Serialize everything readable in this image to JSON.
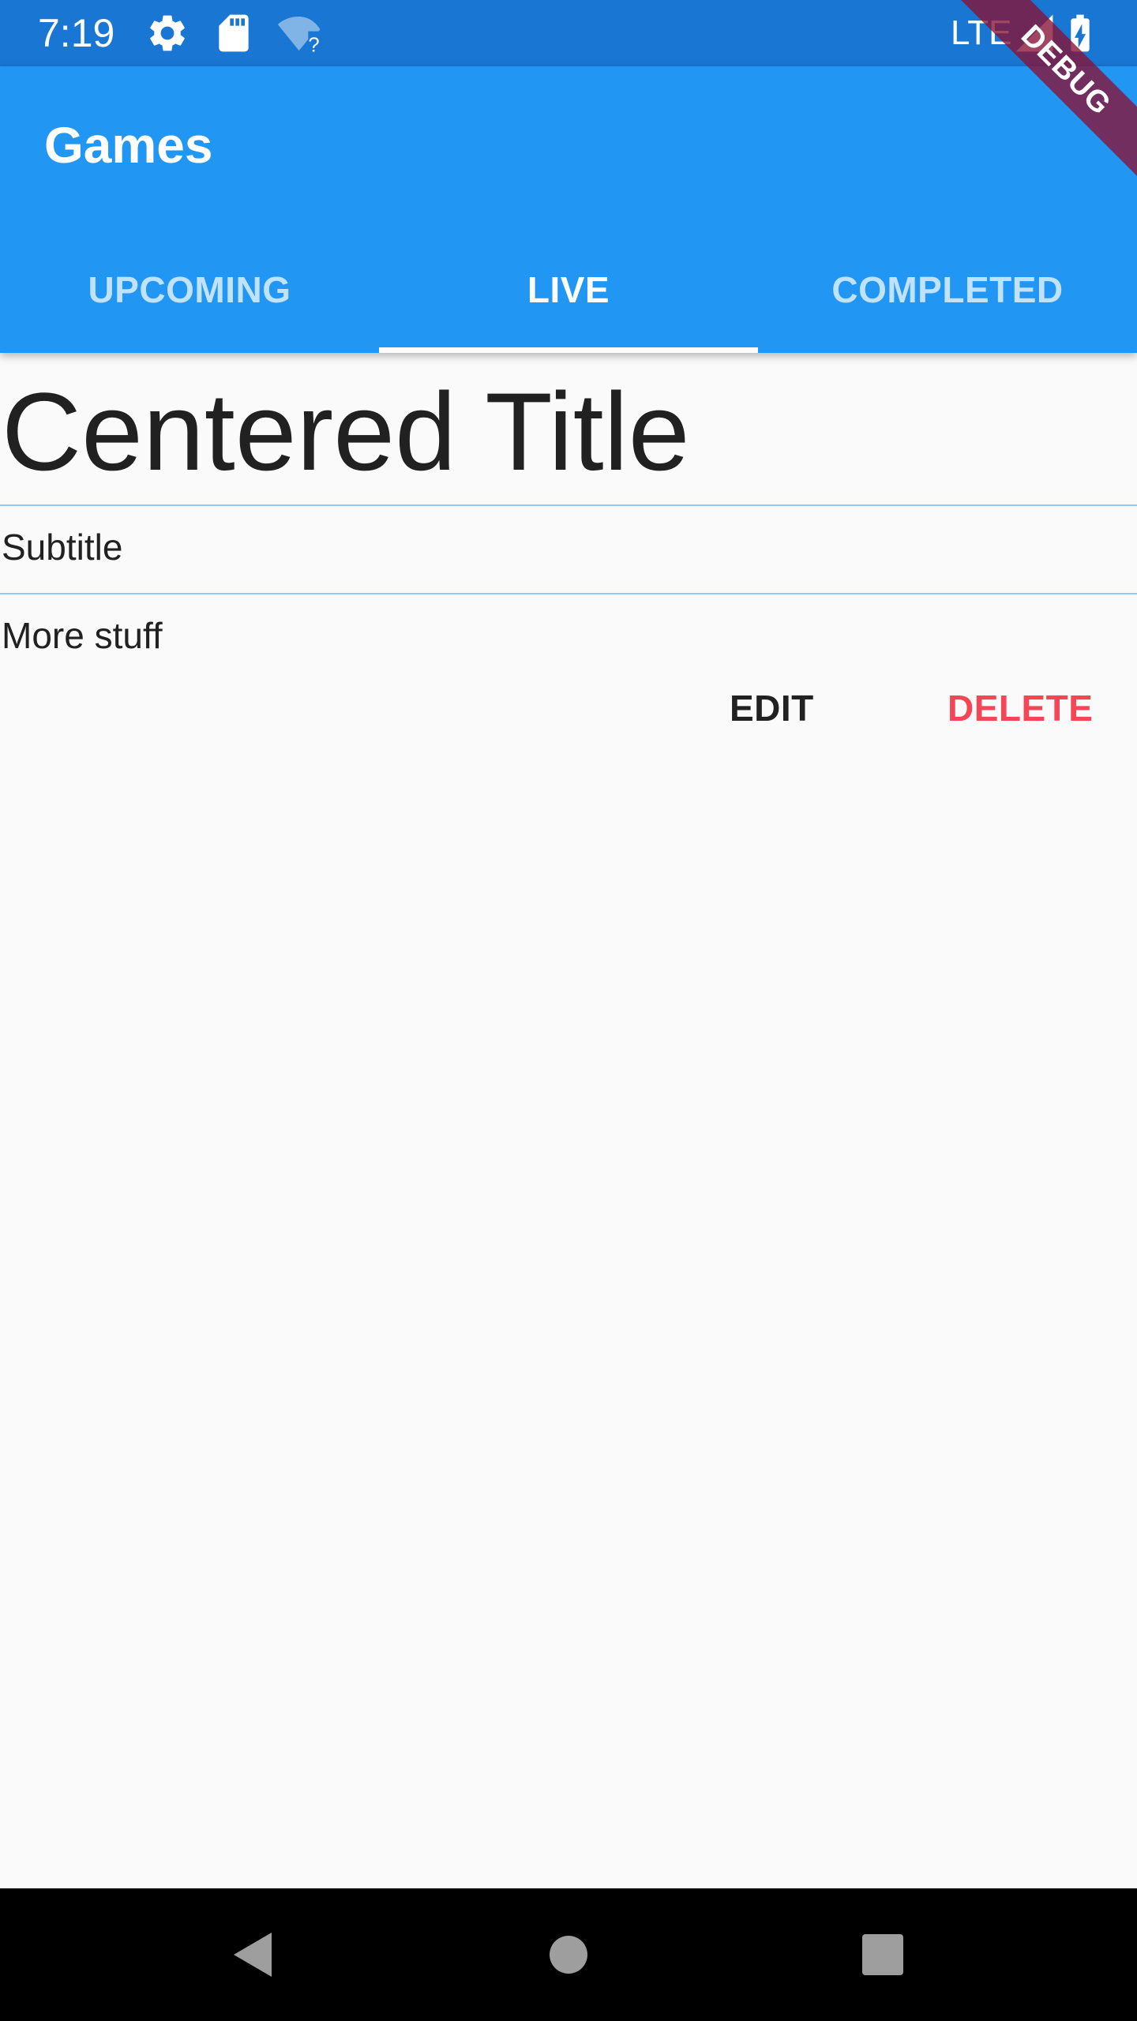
{
  "status_bar": {
    "time": "7:19",
    "network": "LTE",
    "icons": [
      "settings-icon",
      "sd-card-icon",
      "wifi-question-icon",
      "signal-icon",
      "battery-charging-icon"
    ]
  },
  "app_bar": {
    "title": "Games",
    "tabs": [
      {
        "label": "UPCOMING",
        "selected": false
      },
      {
        "label": "LIVE",
        "selected": true
      },
      {
        "label": "COMPLETED",
        "selected": false
      }
    ]
  },
  "debug_banner": "DEBUG",
  "card": {
    "title": "Centered Title",
    "subtitle": "Subtitle",
    "body": "More stuff",
    "edit_label": "EDIT",
    "delete_label": "DELETE"
  },
  "nav_bar": {
    "icons": [
      "back-icon",
      "home-icon",
      "recents-icon"
    ]
  },
  "colors": {
    "status_bar": "#1976d2",
    "app_bar": "#2196f3",
    "background": "#fafafa",
    "divider": "#90caf9",
    "delete": "#f44655",
    "debug_banner": "#881134"
  }
}
